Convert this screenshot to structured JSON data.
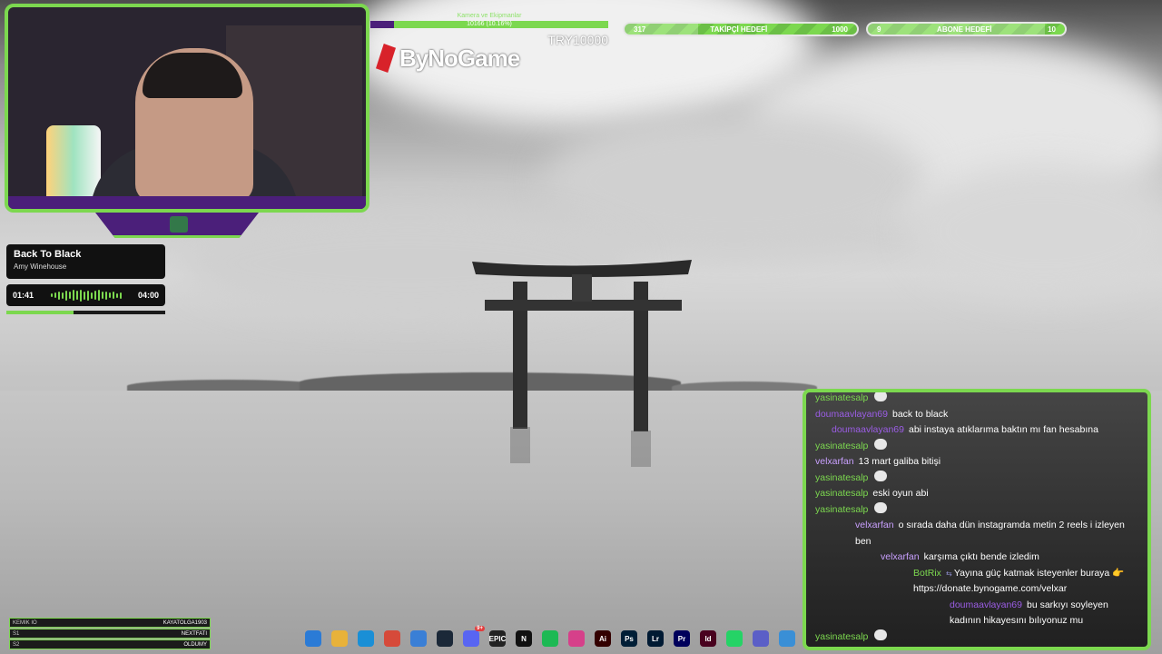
{
  "donation": {
    "title": "Kamera ve Ekipmanlar",
    "progress_text": "10166 (10.16%)",
    "progress_fraction": 0.1,
    "goal_text": "TRY10000",
    "brand": "ByNoGame",
    "fill_color": "#4b1f7a",
    "track_color": "#7cd84f"
  },
  "goals": [
    {
      "current": "317",
      "label": "TAKİPÇİ HEDEFİ",
      "target": "1000",
      "fraction": 0.317
    },
    {
      "current": "9",
      "label": "ABONE HEDEFİ",
      "target": "10",
      "fraction": 0.9
    }
  ],
  "now_playing": {
    "title": "Back To Black",
    "artist": "Amy Winehouse",
    "elapsed": "01:41",
    "duration": "04:00",
    "progress_fraction": 0.42
  },
  "leaderboard": [
    {
      "label": "KEMIK IO",
      "value": "KAYATOLGA1903"
    },
    {
      "label": "S1",
      "value": "NEXTFATI"
    },
    {
      "label": "S2",
      "value": "OLDUMY"
    }
  ],
  "taskbar": {
    "icons": [
      {
        "name": "start-icon",
        "label": "",
        "color": "#2b7bd6"
      },
      {
        "name": "file-explorer-icon",
        "label": "",
        "color": "#e8b23a"
      },
      {
        "name": "edge-icon",
        "label": "",
        "color": "#1a8fd6"
      },
      {
        "name": "chrome-icon",
        "label": "",
        "color": "#d64a3a"
      },
      {
        "name": "store-icon",
        "label": "",
        "color": "#3a7fd6"
      },
      {
        "name": "steam-icon",
        "label": "",
        "color": "#1b2838"
      },
      {
        "name": "discord-icon",
        "label": "",
        "color": "#5865f2"
      },
      {
        "name": "epic-games-icon",
        "label": "EPIC",
        "color": "#222222"
      },
      {
        "name": "netflix-icon",
        "label": "N",
        "color": "#111111"
      },
      {
        "name": "spotify-icon",
        "label": "",
        "color": "#1db954"
      },
      {
        "name": "instagram-icon",
        "label": "",
        "color": "#d6408a"
      },
      {
        "name": "illustrator-icon",
        "label": "Ai",
        "color": "#330000"
      },
      {
        "name": "photoshop-icon",
        "label": "Ps",
        "color": "#001e36"
      },
      {
        "name": "lightroom-icon",
        "label": "Lr",
        "color": "#001a33"
      },
      {
        "name": "premiere-icon",
        "label": "Pr",
        "color": "#00005b"
      },
      {
        "name": "indesign-icon",
        "label": "Id",
        "color": "#49021f"
      },
      {
        "name": "whatsapp-icon",
        "label": "",
        "color": "#25d366"
      },
      {
        "name": "teams-icon",
        "label": "",
        "color": "#5b5fc7"
      },
      {
        "name": "app-icon",
        "label": "",
        "color": "#3a8fd6"
      }
    ],
    "discord_badge": "9+"
  },
  "chat": {
    "messages": [
      {
        "user": "yasinatesalp",
        "color": "#7cd84f",
        "text": "",
        "emote": true,
        "indent": 0
      },
      {
        "user": "doumaavlayan69",
        "color": "#9b5de5",
        "text": "back to black",
        "emote": false,
        "indent": 0
      },
      {
        "user": "doumaavlayan69",
        "color": "#9b5de5",
        "text": "abi instaya atıklarıma baktın mı fan hesabına",
        "emote": false,
        "indent": 1
      },
      {
        "user": "yasinatesalp",
        "color": "#7cd84f",
        "text": "",
        "emote": true,
        "indent": 0
      },
      {
        "user": "velxarfan",
        "color": "#c9a0ff",
        "text": "13 mart galiba bitişi",
        "emote": false,
        "indent": 0
      },
      {
        "user": "yasinatesalp",
        "color": "#7cd84f",
        "text": "",
        "emote": true,
        "indent": 0
      },
      {
        "user": "yasinatesalp",
        "color": "#7cd84f",
        "text": "eski oyun abi",
        "emote": false,
        "indent": 0
      },
      {
        "user": "yasinatesalp",
        "color": "#7cd84f",
        "text": "",
        "emote": true,
        "indent": 0
      },
      {
        "user": "velxarfan",
        "color": "#c9a0ff",
        "text": "o sırada daha dün instagramda metin 2 reels i izleyen ben",
        "emote": false,
        "indent": 2
      },
      {
        "user": "velxarfan",
        "color": "#c9a0ff",
        "text": "karşıma çıktı bende izledim",
        "emote": false,
        "indent": 3
      },
      {
        "user": "BotRix",
        "color": "#7cd84f",
        "text": "Yayına güç katmak isteyenler buraya 👉 https://donate.bynogame.com/velxar",
        "emote": false,
        "indent": 4
      },
      {
        "user": "doumaavlayan69",
        "color": "#9b5de5",
        "text": "bu sarkıyı soyleyen kadının hikayesını bılıyonuz mu",
        "emote": false,
        "indent": 5
      },
      {
        "user": "yasinatesalp",
        "color": "#7cd84f",
        "text": "",
        "emote": true,
        "indent": 0
      }
    ]
  },
  "colors": {
    "accent": "#7cd84f",
    "purple": "#4b1f7a"
  }
}
